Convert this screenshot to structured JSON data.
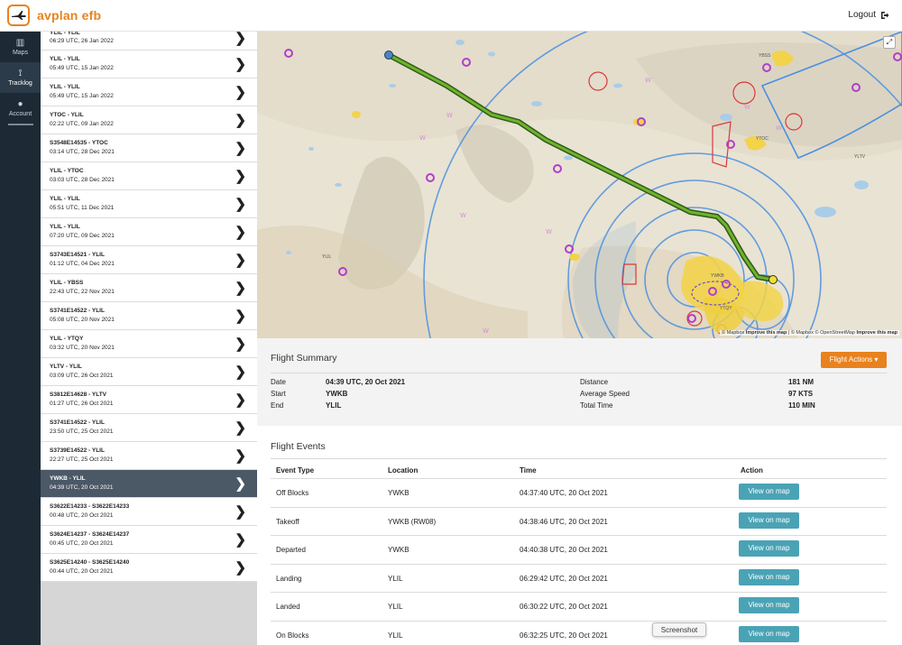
{
  "app": {
    "logo_text": "avplan efb",
    "logout_label": "Logout",
    "colors": {
      "brand": "#e8821e",
      "rail": "#1d2a36",
      "action_button": "#4aa3b5",
      "active_row": "#4b5866"
    }
  },
  "rail": {
    "items": [
      {
        "label": "Maps",
        "icon": "map-icon"
      },
      {
        "label": "Tracklog",
        "icon": "tracklog-icon"
      },
      {
        "label": "Account",
        "icon": "user-icon"
      }
    ]
  },
  "tracks": [
    {
      "route": "YLIL - YLIL",
      "time": "06:29 UTC, 26 Jan 2022"
    },
    {
      "route": "YLIL - YLIL",
      "time": "05:49 UTC, 15 Jan 2022"
    },
    {
      "route": "YLIL - YLIL",
      "time": "05:49 UTC, 15 Jan 2022"
    },
    {
      "route": "YTOC - YLIL",
      "time": "02:22 UTC, 09 Jan 2022"
    },
    {
      "route": "S3548E14535 - YTOC",
      "time": "03:14 UTC, 28 Dec 2021"
    },
    {
      "route": "YLIL - YTOC",
      "time": "03:03 UTC, 28 Dec 2021"
    },
    {
      "route": "YLIL - YLIL",
      "time": "05:51 UTC, 11 Dec 2021"
    },
    {
      "route": "YLIL - YLIL",
      "time": "07:20 UTC, 09 Dec 2021"
    },
    {
      "route": "S3743E14521 - YLIL",
      "time": "01:12 UTC, 04 Dec 2021"
    },
    {
      "route": "YLIL - YBSS",
      "time": "22:43 UTC, 22 Nov 2021"
    },
    {
      "route": "S3741E14522 - YLIL",
      "time": "05:08 UTC, 20 Nov 2021"
    },
    {
      "route": "YLIL - YTQY",
      "time": "03:32 UTC, 20 Nov 2021"
    },
    {
      "route": "YLTV - YLIL",
      "time": "03:09 UTC, 26 Oct 2021"
    },
    {
      "route": "S3812E14628 - YLTV",
      "time": "01:27 UTC, 26 Oct 2021"
    },
    {
      "route": "S3741E14522 - YLIL",
      "time": "23:50 UTC, 25 Oct 2021"
    },
    {
      "route": "S3739E14522 - YLIL",
      "time": "22:27 UTC, 25 Oct 2021"
    },
    {
      "route": "YWKB - YLIL",
      "time": "04:39 UTC, 20 Oct 2021",
      "selected": true
    },
    {
      "route": "S3622E14233 - S3622E14233",
      "time": "00:48 UTC, 20 Oct 2021"
    },
    {
      "route": "S3624E14237 - S3624E14237",
      "time": "00:45 UTC, 20 Oct 2021"
    },
    {
      "route": "S3625E14240 - S3625E14240",
      "time": "00:44 UTC, 20 Oct 2021"
    }
  ],
  "map": {
    "attribution_prefix": "© Mapbox",
    "attribution_link1": "Improve this map",
    "attribution_mid": "| © Mapbox © OpenStreetMap",
    "attribution_link2": "Improve this map",
    "labels": [
      "YLIL",
      "YBSS",
      "YTOC",
      "YLTV",
      "YWKB",
      "YTQY"
    ]
  },
  "summary": {
    "title": "Flight Summary",
    "actions_label": "Flight Actions ▾",
    "date_label": "Date",
    "date_value": "04:39 UTC, 20 Oct 2021",
    "start_label": "Start",
    "start_value": "YWKB",
    "end_label": "End",
    "end_value": "YLIL",
    "distance_label": "Distance",
    "distance_value": "181 NM",
    "speed_label": "Average Speed",
    "speed_value": "97 KTS",
    "total_label": "Total Time",
    "total_value": "110 MIN"
  },
  "events": {
    "title": "Flight Events",
    "columns": [
      "Event Type",
      "Location",
      "Time",
      "Action"
    ],
    "button_label": "View on map",
    "rows": [
      {
        "type": "Off Blocks",
        "location": "YWKB",
        "time": "04:37:40 UTC, 20 Oct 2021"
      },
      {
        "type": "Takeoff",
        "location": "YWKB (RW08)",
        "time": "04:38:46 UTC, 20 Oct 2021"
      },
      {
        "type": "Departed",
        "location": "YWKB",
        "time": "04:40:38 UTC, 20 Oct 2021"
      },
      {
        "type": "Landing",
        "location": "YLIL",
        "time": "06:29:42 UTC, 20 Oct 2021"
      },
      {
        "type": "Landed",
        "location": "YLIL",
        "time": "06:30:22 UTC, 20 Oct 2021"
      },
      {
        "type": "On Blocks",
        "location": "YLIL",
        "time": "06:32:25 UTC, 20 Oct 2021"
      }
    ]
  },
  "tooltip": "Screenshot"
}
